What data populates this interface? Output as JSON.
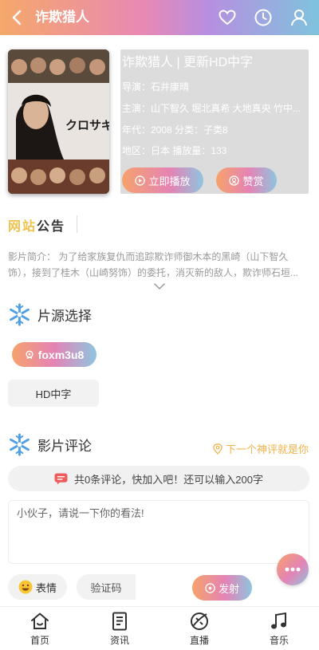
{
  "header": {
    "title": "诈欺猎人"
  },
  "movie": {
    "title": "诈欺猎人 | 更新HD中字",
    "director": "导演：石井康晴",
    "cast": "主演：山下智久 堀北真希 大地真央 竹中...",
    "year_genre": "年代：2008  分类：子类8",
    "region_plays": "地区：日本  播放量：133",
    "play_label": "立即播放",
    "reward_label": "赞赏",
    "poster_text": "クロサギ"
  },
  "notice": {
    "logo_part1": "网站",
    "logo_part2": "公告",
    "desc": "影片简介：       为了给家族复仇而追踪欺诈师御木本的黑崎（山下智久饰），接到了桂木（山崎努饰）的委托，消灭新的敌人，欺诈师石垣..."
  },
  "source": {
    "title": "片源选择",
    "pill": "foxm3u8",
    "episode": "HD中字"
  },
  "comments": {
    "title": "影片评论",
    "next_label": "下一个神评就是你",
    "bar_text": "共0条评论，快加入吧！还可以输入200字",
    "textarea_placeholder": "小伙子，请说一下你的看法!",
    "emoji_label": "表情",
    "captcha_placeholder": "验证码",
    "send_label": "发射"
  },
  "tabbar": {
    "items": [
      {
        "label": "首页",
        "icon": "home-icon"
      },
      {
        "label": "资讯",
        "icon": "news-icon"
      },
      {
        "label": "直播",
        "icon": "live-icon"
      },
      {
        "label": "音乐",
        "icon": "music-icon"
      }
    ]
  },
  "colors": {
    "gradient_start": "#f5a86a",
    "gradient_mid": "#e483b5",
    "gradient_end": "#8fc5e0",
    "accent_yellow": "#f0b24a",
    "snowflake_blue": "#4f9fe6"
  }
}
